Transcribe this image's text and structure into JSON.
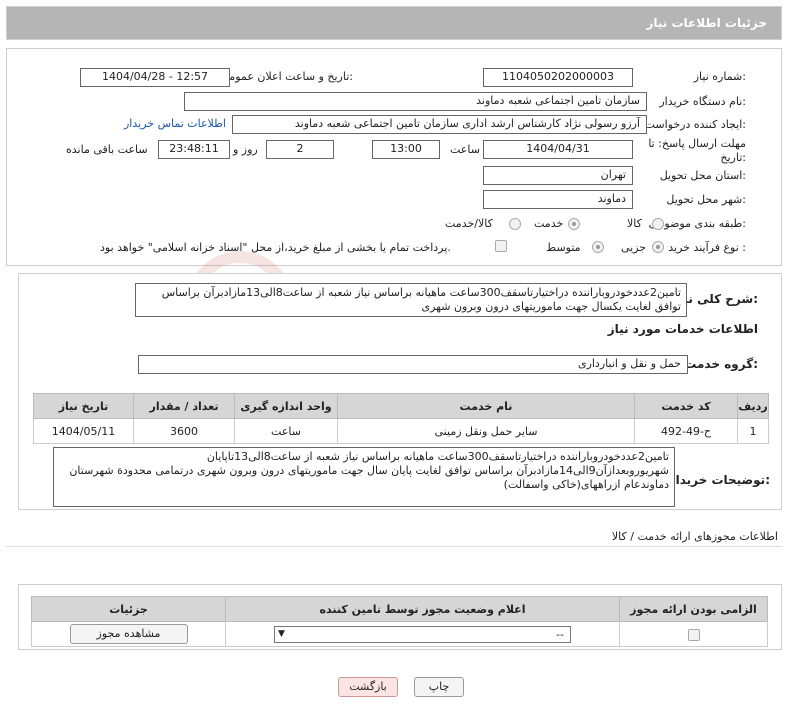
{
  "page": {
    "title": "جزئیات اطلاعات نیاز"
  },
  "form": {
    "need_number_label": "شماره نیاز:",
    "need_number": "1104050202000003",
    "announce_label": "تاریخ و ساعت اعلان عمومی:",
    "announce_value": "1404/04/28 - 12:57",
    "buyer_org_label": "نام دستگاه خریدار:",
    "buyer_org": "سازمان تامین اجتماعی شعبه دماوند",
    "creator_label": "ایجاد کننده درخواست:",
    "creator": "آرزو رسولی نژاد کارشناس ارشد اداری سازمان تامین اجتماعی شعبه دماوند",
    "contact_link": "اطلاعات تماس خریدار",
    "deadline_label": "مهلت ارسال پاسخ: تا تاریخ:",
    "deadline_date": "1404/04/31",
    "time_label": "ساعت",
    "deadline_time": "13:00",
    "days_value": "2",
    "days_label": "روز و",
    "remaining_time": "23:48:11",
    "remaining_label": "ساعت باقی مانده",
    "province_label": "استان محل تحویل:",
    "province": "تهران",
    "city_label": "شهر محل تحویل:",
    "city": "دماوند",
    "category_label": "طبقه بندی موضوعی:",
    "category_options": [
      "کالا",
      "خدمت",
      "کالا/خدمت"
    ],
    "category_selected": "خدمت",
    "purchase_type_label": "نوع فرآیند خرید :",
    "purchase_options": [
      "جزیی",
      "متوسط"
    ],
    "purchase_selected": "متوسط",
    "payment_note": "پرداخت تمام یا بخشی از مبلغ خرید،از محل \"اسناد خزانه اسلامی\" خواهد بود."
  },
  "summary": {
    "label": "شرح کلی نیاز:",
    "text": "تامین2عددخودروباراننده دراختیارتاسقف300ساعت ماهیانه براساس نیاز شعبه از ساعت8الی13مازادبرآن براساس توافق لغایت یکسال جهت ماموریتهای درون وبرون شهری"
  },
  "services": {
    "section_title": "اطلاعات خدمات مورد نیاز",
    "group_label": "گروه خدمت:",
    "group_value": "حمل و نقل و انبارداری",
    "table": {
      "headers": [
        "ردیف",
        "کد خدمت",
        "نام خدمت",
        "واحد اندازه گیری",
        "تعداد / مقدار",
        "تاریخ نیاز"
      ],
      "rows": [
        [
          "1",
          "ح-49-492",
          "سایر حمل ونقل زمینی",
          "ساعت",
          "3600",
          "1404/05/11"
        ]
      ]
    }
  },
  "buyer_notes": {
    "label": "توضیحات خریدار:",
    "text": "تامین2عددخودروباراننده دراختیارتاسقف300ساعت ماهیانه براساس نیاز شعبه از ساعت8الی13تاپایان شهریوروبعدازآن9الی14مازادبرآن براساس توافق لغایت پایان سال جهت ماموریتهای درون وبرون شهری درتمامی محدودة شهرستان دماوندعام ازراههای(خاکی واسفالت)"
  },
  "permits": {
    "section_title": "اطلاعات مجوزهای ارائه خدمت / کالا",
    "headers": [
      "الزامی بودن ارائه مجوز",
      "اعلام وضعیت مجوز توسط تامین کننده",
      "جزئیات"
    ],
    "select_value": "--",
    "view_button": "مشاهده مجوز"
  },
  "actions": {
    "print": "چاپ",
    "back": "بازگشت"
  },
  "watermark_text": "AriaTender.neT"
}
